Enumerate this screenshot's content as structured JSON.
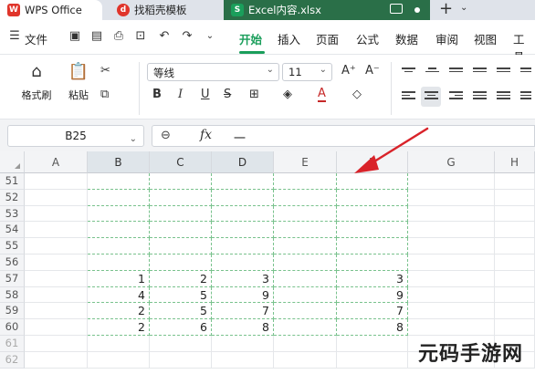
{
  "tabs": {
    "wps": "WPS Office",
    "find_template": "找稻壳模板",
    "file": "Excel内容.xlsx",
    "new_tab": "+"
  },
  "menu": {
    "file": "文件",
    "items": [
      "开始",
      "插入",
      "页面",
      "公式",
      "数据",
      "审阅",
      "视图",
      "工具"
    ],
    "active": "开始"
  },
  "ribbon": {
    "format_painter": "格式刷",
    "paste": "粘贴",
    "font_name": "等线",
    "font_size": "11",
    "bold": "B",
    "italic": "I",
    "underline": "U",
    "strike": "S",
    "increase_font": "A⁺",
    "decrease_font": "A⁻",
    "font_color": "A"
  },
  "formula_bar": {
    "cell_ref": "B25",
    "fx": "fx",
    "value": "一"
  },
  "columns": [
    "A",
    "B",
    "C",
    "D",
    "E",
    "F",
    "G",
    "H"
  ],
  "rows": [
    "51",
    "52",
    "53",
    "54",
    "55",
    "56",
    "57",
    "58",
    "59",
    "60",
    "61",
    "62"
  ],
  "data": {
    "r57": {
      "B": "1",
      "C": "2",
      "D": "3",
      "F": "3"
    },
    "r58": {
      "B": "4",
      "C": "5",
      "D": "9",
      "F": "9"
    },
    "r59": {
      "B": "2",
      "C": "5",
      "D": "7",
      "F": "7"
    },
    "r60": {
      "B": "2",
      "C": "6",
      "D": "8",
      "F": "8"
    }
  },
  "watermark": "元码手游网",
  "colors": {
    "accent": "#1a9e5b",
    "excel_tab": "#2a6f48",
    "arrow": "#d9232a"
  }
}
